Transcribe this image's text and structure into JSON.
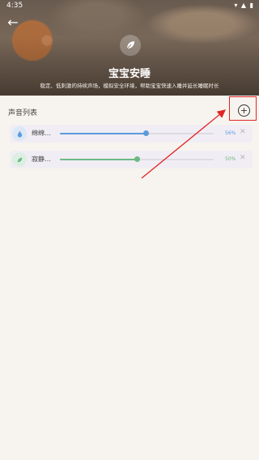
{
  "status": {
    "time": "4:35",
    "right": "▾ ▲ ▮"
  },
  "header": {
    "title": "宝宝安睡",
    "subtitle": "稳定、低刺激的持续声场，模拟安全环境，帮助宝宝快速入睡并延长睡眠时长"
  },
  "section": {
    "title": "声音列表"
  },
  "sounds": [
    {
      "label": "绵绵…",
      "percent_text": "56%",
      "level": 0.56,
      "color": "#5b9bdc",
      "icon": "water-drop-icon"
    },
    {
      "label": "寂静…",
      "percent_text": "50%",
      "level": 0.5,
      "color": "#6cba83",
      "icon": "leaf-sprout-icon"
    }
  ],
  "colors": {
    "highlight": "#e02525",
    "background": "#f7f4ef"
  }
}
